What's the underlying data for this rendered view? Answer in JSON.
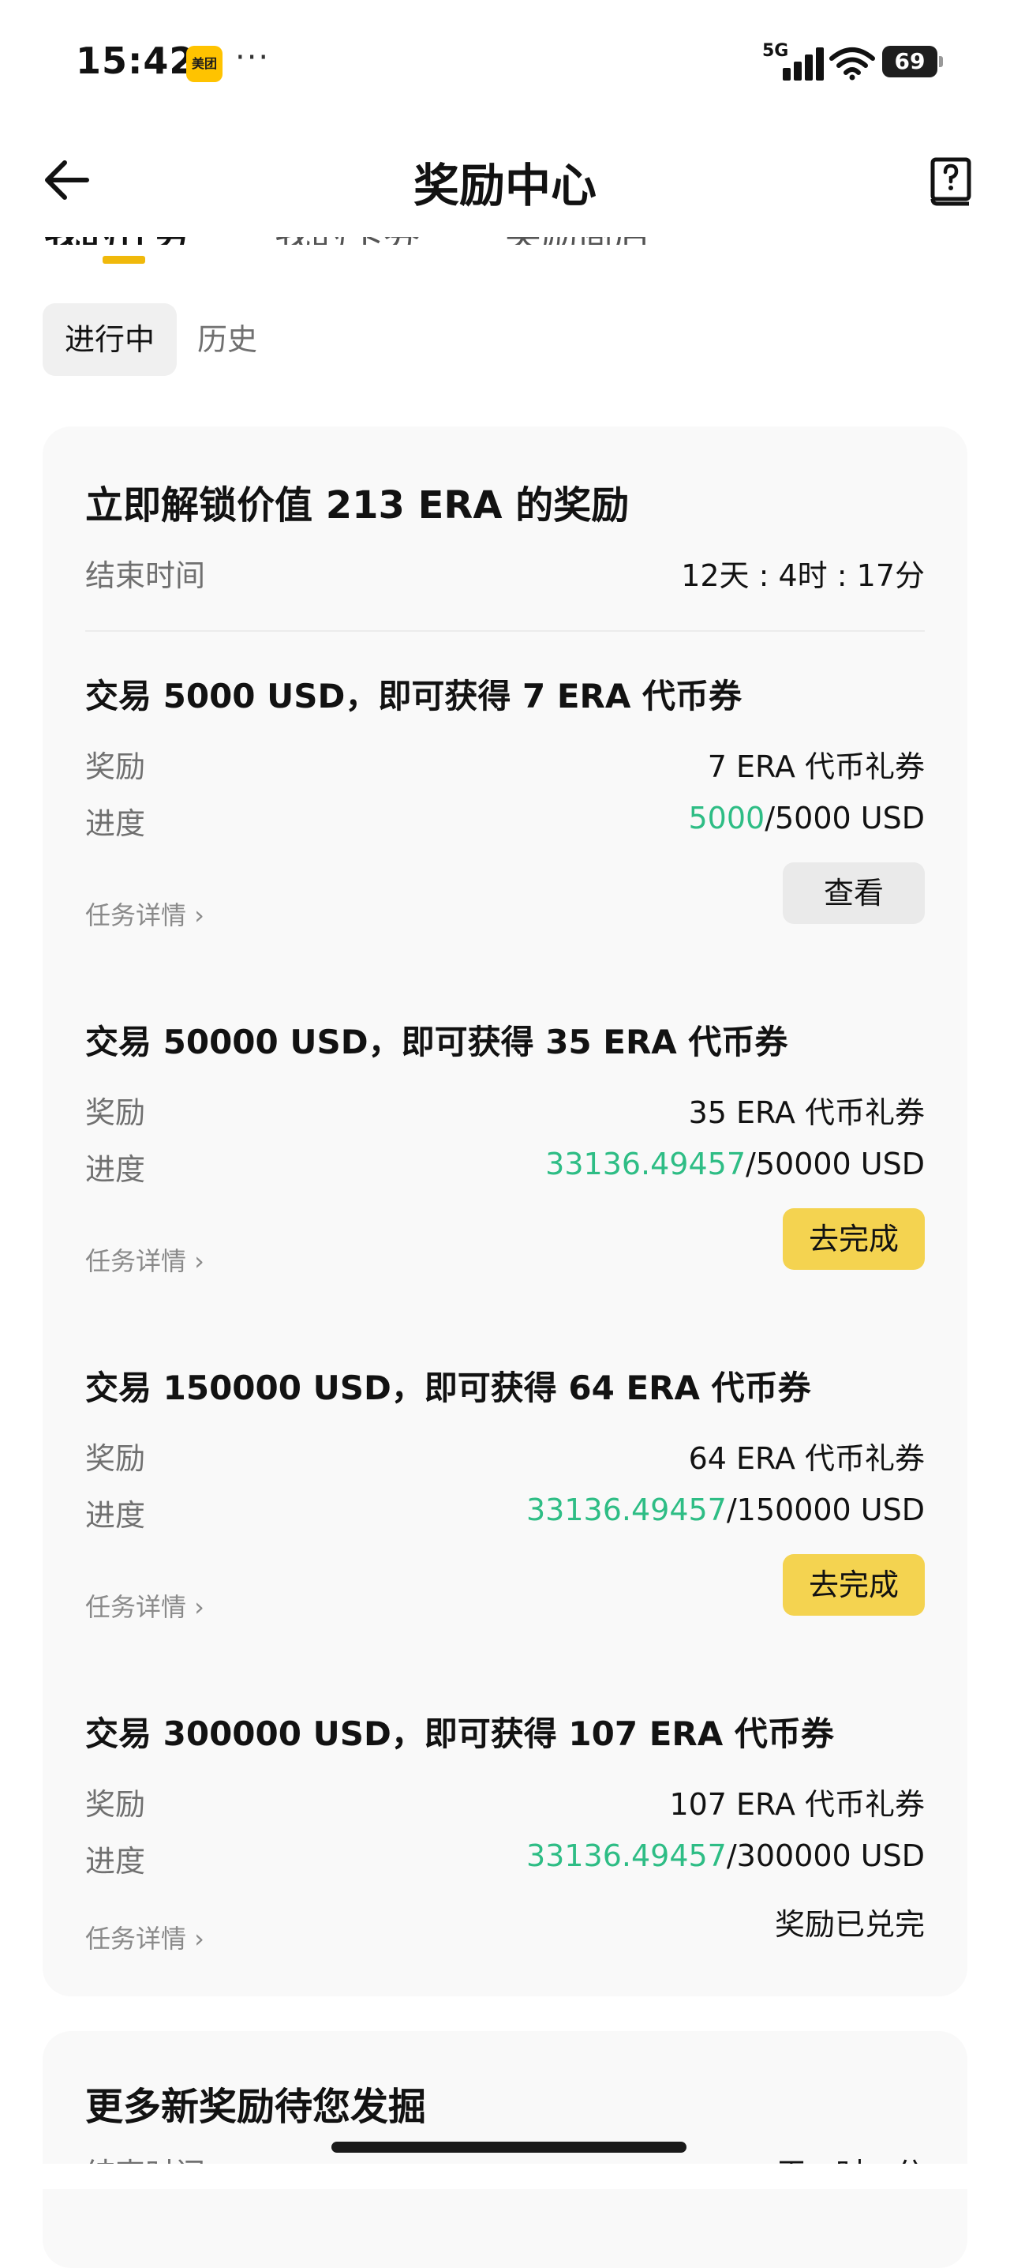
{
  "status_bar": {
    "time": "15:42",
    "app_badge": "美团",
    "more": "···",
    "network": "5G",
    "battery": "69"
  },
  "nav": {
    "title": "奖励中心",
    "back_icon": "arrow-left-icon",
    "help_icon": "help-book-icon"
  },
  "tabs": [
    {
      "label": "我的任务",
      "active": true
    },
    {
      "label": "我的卡券",
      "active": false
    },
    {
      "label": "奖励商店",
      "active": false
    }
  ],
  "sub_tabs": {
    "active": "进行中",
    "history": "历史"
  },
  "card": {
    "title": "立即解锁价值 213 ERA 的奖励",
    "end_label": "结束时间",
    "end_value": "12天 : 4时 : 17分",
    "tasks": [
      {
        "title": "交易 5000 USD，即可获得 7 ERA 代币券",
        "reward_label": "奖励",
        "reward": "7 ERA 代币礼券",
        "progress_label": "进度",
        "progress_current": "5000",
        "progress_target": "/5000 USD",
        "detail": "任务详情 ›",
        "action": "查看"
      },
      {
        "title": "交易 50000 USD，即可获得 35 ERA 代币券",
        "reward_label": "奖励",
        "reward": "35 ERA 代币礼券",
        "progress_label": "进度",
        "progress_current": "33136.49457",
        "progress_target": "/50000 USD",
        "detail": "任务详情 ›",
        "action": "去完成"
      },
      {
        "title": "交易 150000 USD，即可获得 64 ERA 代币券",
        "reward_label": "奖励",
        "reward": "64 ERA 代币礼券",
        "progress_label": "进度",
        "progress_current": "33136.49457",
        "progress_target": "/150000 USD",
        "detail": "任务详情 ›",
        "action": "去完成"
      },
      {
        "title": "交易 300000 USD，即可获得 107 ERA 代币券",
        "reward_label": "奖励",
        "reward": "107 ERA 代币礼券",
        "progress_label": "进度",
        "progress_current": "33136.49457",
        "progress_target": "/300000 USD",
        "detail": "任务详情 ›",
        "status": "奖励已兑完"
      }
    ]
  },
  "more_card": {
    "title": "更多新奖励待您发掘",
    "end_label": "结束时间",
    "end_value": "天 : 时 : 分"
  },
  "colors": {
    "accent_yellow": "#F0B90B",
    "button_yellow": "#F4D350",
    "progress_green": "#2EBD85",
    "card_bg": "#F9F9F9"
  }
}
